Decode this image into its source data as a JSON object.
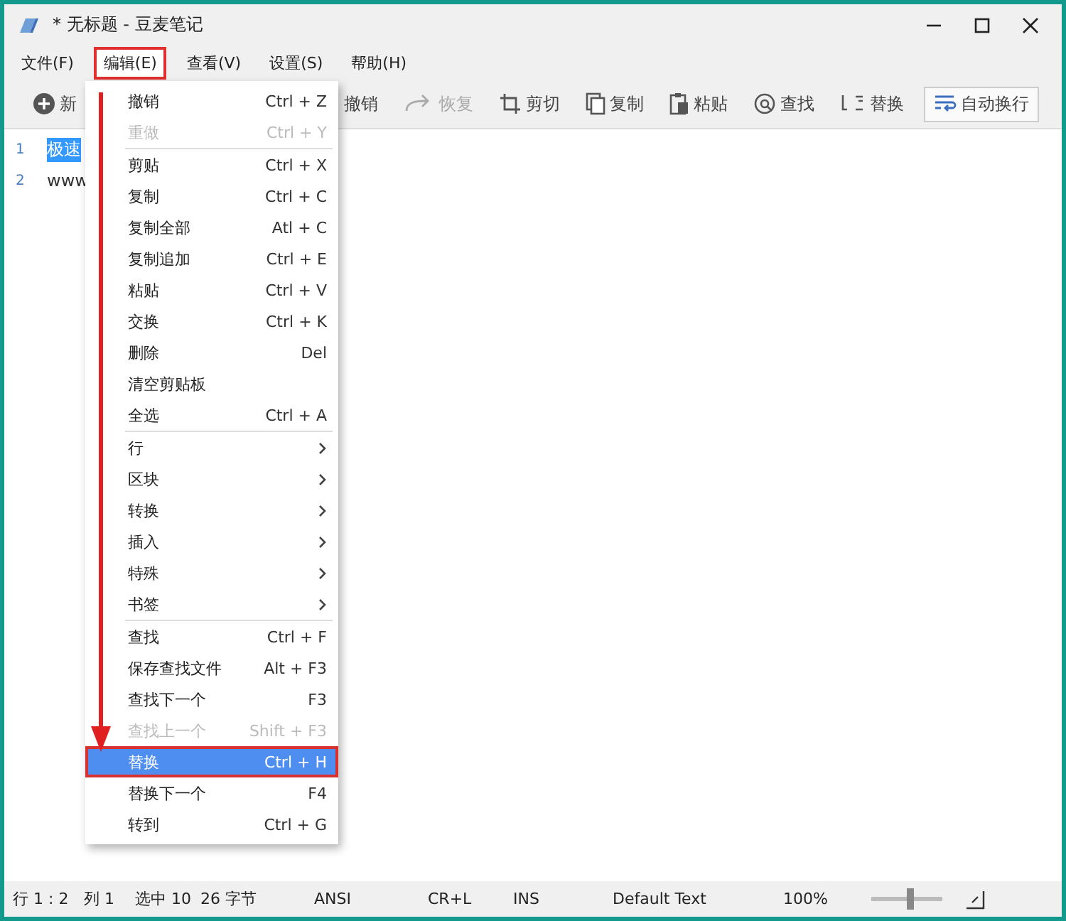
{
  "window": {
    "title": "* 无标题 - 豆麦笔记"
  },
  "menubar": [
    {
      "label": "文件(F)",
      "selected": false,
      "marked": false
    },
    {
      "label": "编辑(E)",
      "selected": true,
      "marked": true
    },
    {
      "label": "查看(V)",
      "selected": false,
      "marked": false
    },
    {
      "label": "设置(S)",
      "selected": false,
      "marked": false
    },
    {
      "label": "帮助(H)",
      "selected": false,
      "marked": false
    }
  ],
  "toolbar": [
    {
      "label": "新",
      "kind": "plus",
      "disabled": false
    },
    {
      "label": "撤销",
      "kind": "undo",
      "disabled": false
    },
    {
      "label": "恢复",
      "kind": "redo",
      "disabled": true
    },
    {
      "label": "剪切",
      "kind": "cut",
      "disabled": false
    },
    {
      "label": "复制",
      "kind": "copy",
      "disabled": false
    },
    {
      "label": "粘贴",
      "kind": "paste",
      "disabled": false
    },
    {
      "label": "查找",
      "kind": "find",
      "disabled": false
    },
    {
      "label": "替换",
      "kind": "replace",
      "disabled": false
    },
    {
      "label": "自动换行",
      "kind": "wrap",
      "disabled": false
    }
  ],
  "editor": {
    "lines": [
      {
        "number": "1",
        "text": "极速",
        "selected": true
      },
      {
        "number": "2",
        "text": "www",
        "selected": false
      }
    ]
  },
  "edit_menu": [
    {
      "kind": "command",
      "label": "撤销",
      "shortcut": "Ctrl + Z",
      "disabled": false,
      "selected": false,
      "marked": false
    },
    {
      "kind": "command",
      "label": "重做",
      "shortcut": "Ctrl + Y",
      "disabled": true,
      "selected": false,
      "marked": false
    },
    {
      "kind": "separator"
    },
    {
      "kind": "command",
      "label": "剪贴",
      "shortcut": "Ctrl + X",
      "disabled": false,
      "selected": false,
      "marked": false
    },
    {
      "kind": "command",
      "label": "复制",
      "shortcut": "Ctrl + C",
      "disabled": false,
      "selected": false,
      "marked": false
    },
    {
      "kind": "command",
      "label": "复制全部",
      "shortcut": "Atl + C",
      "disabled": false,
      "selected": false,
      "marked": false
    },
    {
      "kind": "command",
      "label": "复制追加",
      "shortcut": "Ctrl + E",
      "disabled": false,
      "selected": false,
      "marked": false
    },
    {
      "kind": "command",
      "label": "粘贴",
      "shortcut": "Ctrl + V",
      "disabled": false,
      "selected": false,
      "marked": false
    },
    {
      "kind": "command",
      "label": "交换",
      "shortcut": "Ctrl + K",
      "disabled": false,
      "selected": false,
      "marked": false
    },
    {
      "kind": "command",
      "label": "删除",
      "shortcut": "Del",
      "disabled": false,
      "selected": false,
      "marked": false
    },
    {
      "kind": "command",
      "label": "清空剪贴板",
      "disabled": false,
      "selected": false,
      "marked": false
    },
    {
      "kind": "command",
      "label": "全选",
      "shortcut": "Ctrl + A",
      "disabled": false,
      "selected": false,
      "marked": false
    },
    {
      "kind": "separator"
    },
    {
      "kind": "submenu",
      "label": "行",
      "disabled": false,
      "selected": false,
      "marked": false
    },
    {
      "kind": "submenu",
      "label": "区块",
      "disabled": false,
      "selected": false,
      "marked": false
    },
    {
      "kind": "submenu",
      "label": "转换",
      "disabled": false,
      "selected": false,
      "marked": false
    },
    {
      "kind": "submenu",
      "label": "插入",
      "disabled": false,
      "selected": false,
      "marked": false
    },
    {
      "kind": "submenu",
      "label": "特殊",
      "disabled": false,
      "selected": false,
      "marked": false
    },
    {
      "kind": "submenu",
      "label": "书签",
      "disabled": false,
      "selected": false,
      "marked": false
    },
    {
      "kind": "separator"
    },
    {
      "kind": "command",
      "label": "查找",
      "shortcut": "Ctrl + F",
      "disabled": false,
      "selected": false,
      "marked": false
    },
    {
      "kind": "command",
      "label": "保存查找文件",
      "shortcut": "Alt + F3",
      "disabled": false,
      "selected": false,
      "marked": false
    },
    {
      "kind": "command",
      "label": "查找下一个",
      "shortcut": "F3",
      "disabled": false,
      "selected": false,
      "marked": false
    },
    {
      "kind": "command",
      "label": "查找上一个",
      "shortcut": "Shift + F3",
      "disabled": true,
      "selected": false,
      "marked": false
    },
    {
      "kind": "command",
      "label": "替换",
      "shortcut": "Ctrl + H",
      "disabled": false,
      "selected": true,
      "marked": true
    },
    {
      "kind": "command",
      "label": "替换下一个",
      "shortcut": "F4",
      "disabled": false,
      "selected": false,
      "marked": false
    },
    {
      "kind": "command",
      "label": "转到",
      "shortcut": "Ctrl + G",
      "disabled": false,
      "selected": false,
      "marked": false
    }
  ],
  "status_bar": {
    "items": [
      "行 1 : 2",
      "列 1",
      "选中 10",
      "26 字节",
      "ANSI",
      "CR+L",
      "INS",
      "Default Text",
      "100%"
    ],
    "zoom": {
      "level": 0.5
    }
  }
}
